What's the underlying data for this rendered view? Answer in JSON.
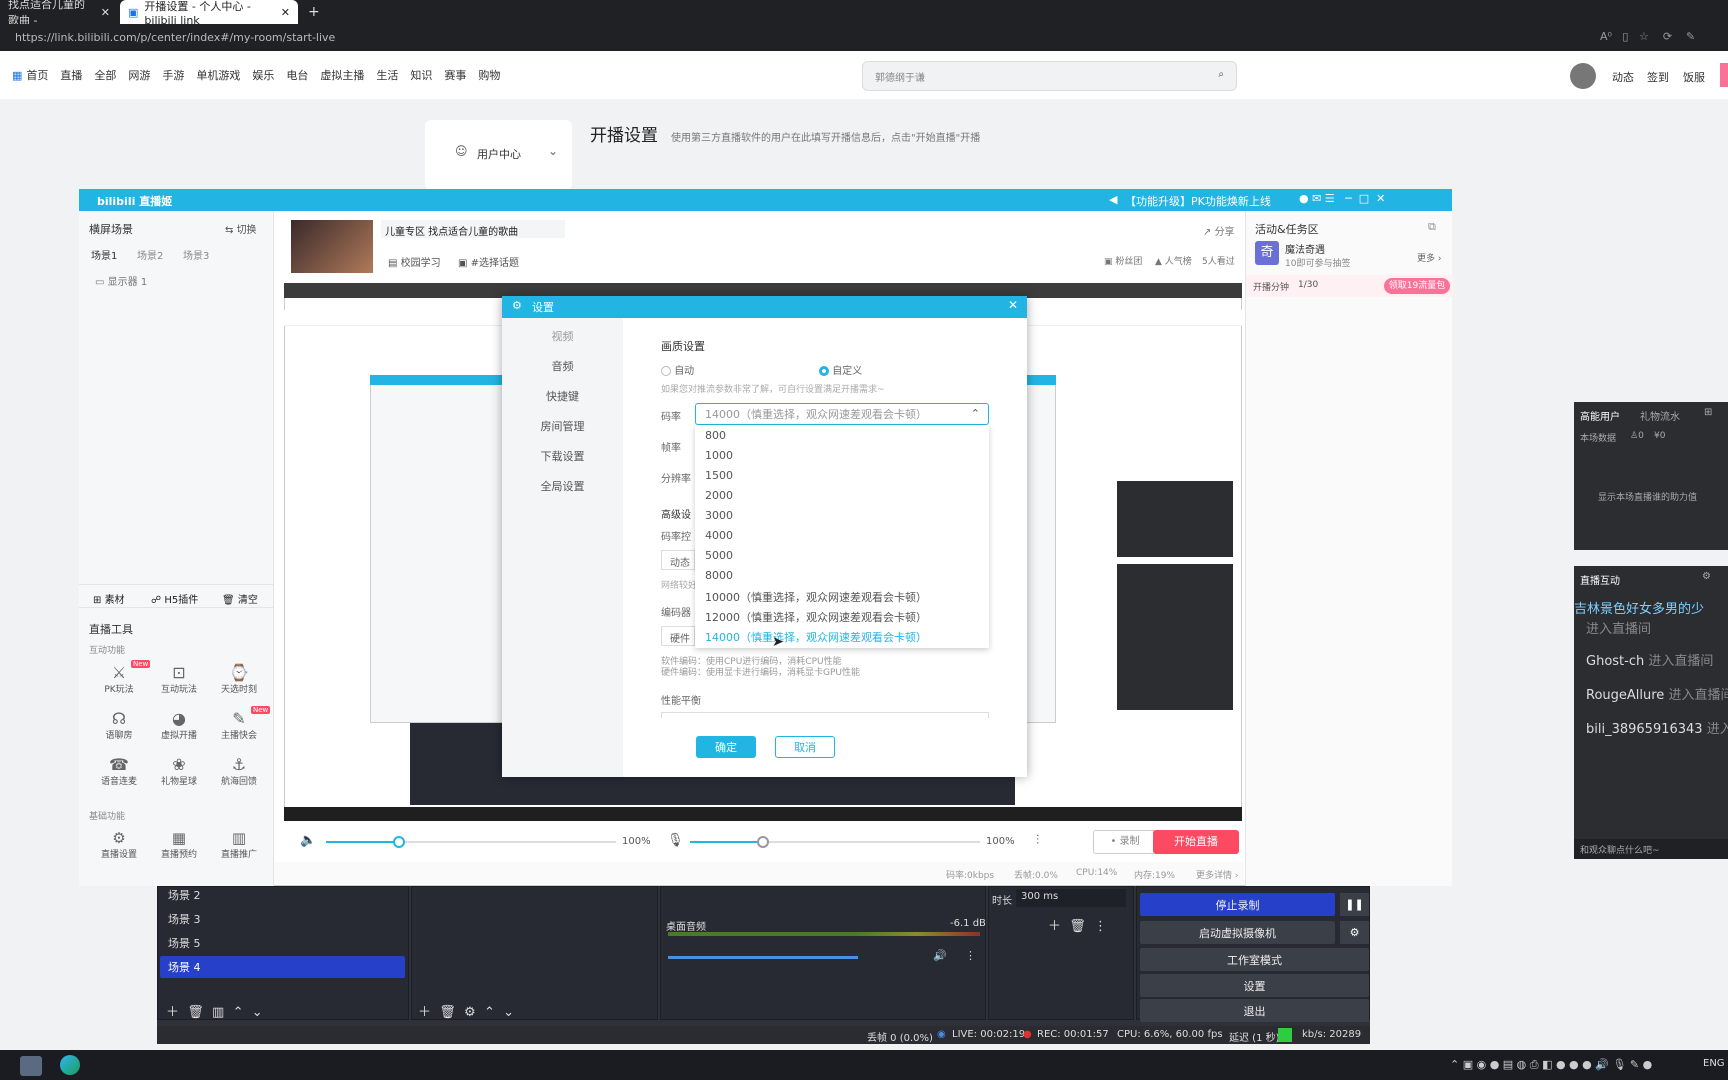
{
  "browser": {
    "tabs": [
      {
        "label": "找点适合儿童的歌曲 -"
      },
      {
        "label": "开播设置 - 个人中心 - bilibili link"
      }
    ],
    "url": "https://link.bilibili.com/p/center/index#/my-room/start-live"
  },
  "site": {
    "nav": [
      "首页",
      "直播",
      "全部",
      "网游",
      "手游",
      "单机游戏",
      "娱乐",
      "电台",
      "虚拟主播",
      "生活",
      "知识",
      "赛事",
      "购物"
    ],
    "search_placeholder": "郭德纲于谦",
    "right_links": [
      "动态",
      "签到",
      "饭服"
    ],
    "user_center": "用户中心",
    "page_title": "开播设置",
    "page_subtitle": "使用第三方直播软件的用户在此填写开播信息后，点击\"开始直播\"开播"
  },
  "app": {
    "brand": "bilibili 直播姬",
    "notice": "【功能升级】PK功能焕新上线",
    "left": {
      "title": "横屏场景",
      "switch": "切换",
      "scenes": [
        "场景1",
        "场景2",
        "场景3"
      ],
      "source": "显示器 1",
      "tools_bar": [
        "素材",
        "H5插件",
        "清空"
      ],
      "tools_title": "直播工具",
      "interactive_title": "互动功能",
      "interactive": [
        "PK玩法",
        "互动玩法",
        "天选时刻",
        "语聊房",
        "虚拟开播",
        "主播快会",
        "语音连麦",
        "礼物星球",
        "航海回馈"
      ],
      "new_badge": "New",
      "basic_title": "基础功能",
      "basic": [
        "直播设置",
        "直播预约",
        "直播推广"
      ]
    },
    "room": {
      "title": "儿童专区 找点适合儿童的歌曲",
      "tags": [
        "校园学习",
        "#选择话题"
      ],
      "share": "分享",
      "stats": [
        "粉丝团",
        "人气榜",
        "5人看过"
      ]
    },
    "right": {
      "title": "活动&任务区",
      "act_name": "魔法奇遇",
      "act_sub": "10即可参与抽签",
      "more": "更多",
      "task": "开播分钟",
      "task_progress": "1/30",
      "task_btn": "领取19流量包"
    },
    "bottom": {
      "vol1": "100%",
      "vol2": "100%",
      "record": "录制",
      "start": "开始直播",
      "vol1_level": 0.25,
      "vol2_level": 0.25
    },
    "status": [
      "码率:0kbps",
      "丢帧:0.0%",
      "CPU:14%",
      "内存:19%",
      "更多详情"
    ]
  },
  "dialog": {
    "title": "设置",
    "side": [
      "视频",
      "音频",
      "快捷键",
      "房间管理",
      "下载设置",
      "全局设置"
    ],
    "section": "画质设置",
    "radio_auto": "自动",
    "radio_custom": "自定义",
    "hint": "如果您对推流参数非常了解，可自行设置满足开播需求~",
    "label_bitrate": "码率",
    "label_fps": "帧率",
    "label_res": "分辨率",
    "label_adv": "高级设",
    "label_ctrl": "码率控",
    "label_dyn": "动态",
    "label_net": "网络较好",
    "label_enc": "编码器",
    "label_hw": "硬件",
    "enc_hint1": "软件编码：使用CPU进行编码，消耗CPU性能",
    "enc_hint2": "硬件编码：使用显卡进行编码，消耗显卡GPU性能",
    "perf": "性能平衡",
    "selected": "14000（慎重选择，观众网速差观看会卡顿）",
    "options": [
      "800",
      "1000",
      "1500",
      "2000",
      "3000",
      "4000",
      "5000",
      "8000",
      "10000（慎重选择，观众网速差观看会卡顿）",
      "12000（慎重选择，观众网速差观看会卡顿）",
      "14000（慎重选择，观众网速差观看会卡顿）"
    ],
    "ok": "确定",
    "cancel": "取消"
  },
  "side_panels": {
    "high_user": "高能用户",
    "gift_flow": "礼物流水",
    "local_data": "本场数据",
    "zero1": "0",
    "zero2": "¥0",
    "hint": "显示本场直播谁的助力值",
    "interact_title": "直播互动",
    "interact": [
      {
        "user": "吉林景色好女多男的少",
        "text": "进入直播间"
      },
      {
        "user": "Ghost-ch",
        "text": "进入直播间"
      },
      {
        "user": "RougeAllure",
        "text": "进入直播间"
      },
      {
        "user": "bili_38965916343",
        "text": "进入"
      }
    ],
    "input": "和观众聊点什么吧~"
  },
  "obs": {
    "scenes": [
      "场景 2",
      "场景 3",
      "场景 5",
      "场景 4"
    ],
    "mixer_label": "桌面音频",
    "mixer_db": "-6.1 dB",
    "duration_label": "时长",
    "duration": "300 ms",
    "controls": [
      "停止录制",
      "启动虚拟摄像机",
      "工作室模式",
      "设置",
      "退出"
    ],
    "status": {
      "dropped": "丢帧 0 (0.0%)",
      "live": "LIVE: 00:02:19",
      "rec": "REC: 00:01:57",
      "cpu": "CPU: 6.6%, 60.00 fps",
      "delay": "延迟 (1 秒)",
      "kbps": "kb/s: 20289"
    }
  },
  "taskbar": {
    "lang": "ENG"
  }
}
